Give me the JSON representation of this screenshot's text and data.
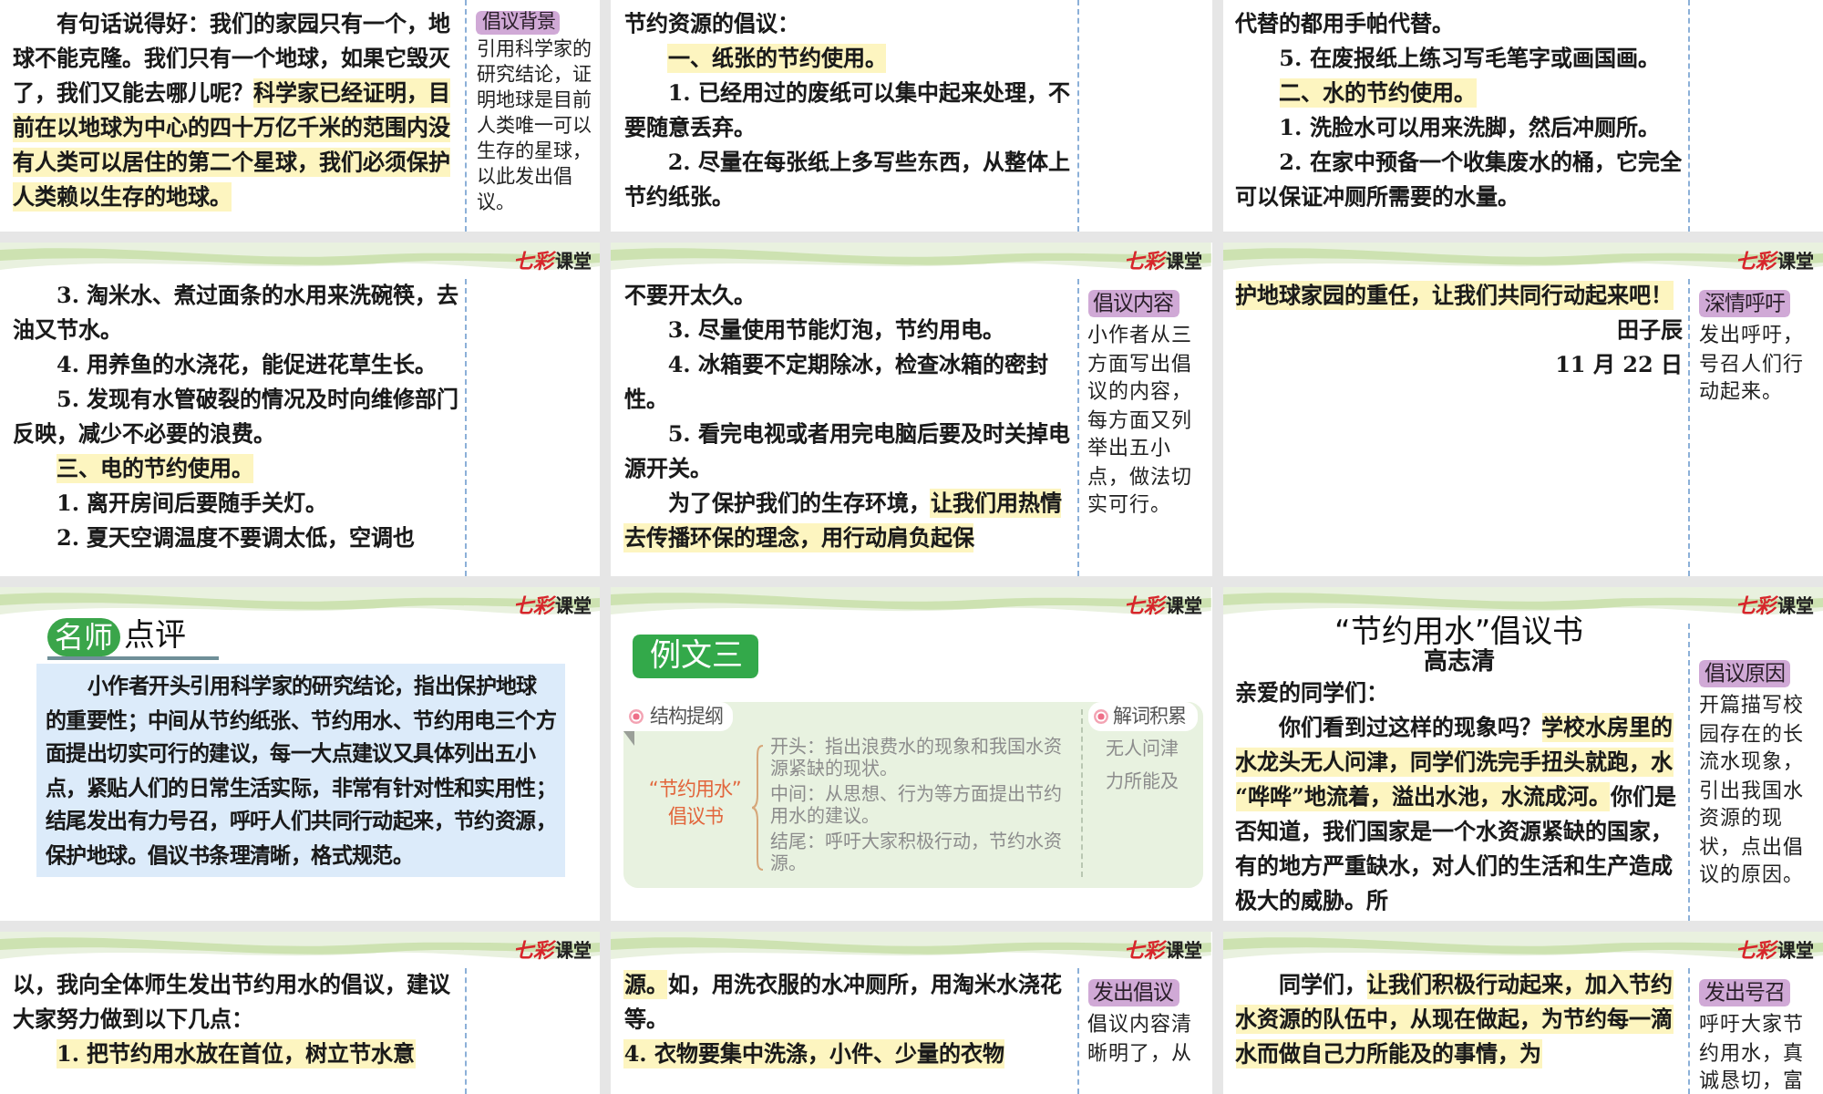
{
  "slides": [
    {
      "kind": "letter",
      "blocks": [
        {
          "kind": "paragraph",
          "indent": true,
          "segments": [
            {
              "text": "有句话说得好：我们的家园只有一个，地球不能克隆。我们只有一个地球，如果它毁灭了，我们又能去哪儿呢？",
              "highlighted": false
            },
            {
              "text": "科学家已经证明，目前在以地球为中心的四十万亿千米的范围内没有人类可以居住的第二个星球，我们必须保护人类赖以生存的地球。",
              "highlighted": true
            }
          ]
        }
      ],
      "note": {
        "label": "倡议背景",
        "text": "引用科学家的研究结论，证明地球是目前人类唯一可以生存的星球，以此发出倡议。"
      }
    },
    {
      "kind": "letter",
      "blocks": [
        {
          "kind": "paragraph",
          "indent": false,
          "segments": [
            {
              "text": "节约资源的倡议：",
              "highlighted": false
            }
          ]
        },
        {
          "kind": "paragraph",
          "indent": true,
          "segments": [
            {
              "text": "一、纸张的节约使用。",
              "highlighted": true
            }
          ]
        },
        {
          "kind": "paragraph",
          "indent": true,
          "segments": [
            {
              "text": "1. 已经用过的废纸可以集中起来处理，不要随意丢弃。",
              "highlighted": false
            }
          ]
        },
        {
          "kind": "paragraph",
          "indent": true,
          "segments": [
            {
              "text": "2. 尽量在每张纸上多写些东西，从整体上节约纸张。",
              "highlighted": false
            }
          ]
        }
      ]
    },
    {
      "kind": "letter",
      "blocks": [
        {
          "kind": "paragraph",
          "indent": false,
          "segments": [
            {
              "text": "代替的都用手帕代替。",
              "highlighted": false
            }
          ]
        },
        {
          "kind": "paragraph",
          "indent": true,
          "segments": [
            {
              "text": "5. 在废报纸上练习写毛笔字或画国画。",
              "highlighted": false
            }
          ]
        },
        {
          "kind": "paragraph",
          "indent": true,
          "segments": [
            {
              "text": "二、水的节约使用。",
              "highlighted": true
            }
          ]
        },
        {
          "kind": "paragraph",
          "indent": true,
          "segments": [
            {
              "text": "1. 洗脸水可以用来洗脚，然后冲厕所。",
              "highlighted": false
            }
          ]
        },
        {
          "kind": "paragraph",
          "indent": true,
          "segments": [
            {
              "text": "2. 在家中预备一个收集废水的桶，它完全可以保证冲厕所需要的水量。",
              "highlighted": false
            }
          ]
        }
      ]
    },
    {
      "kind": "letter",
      "logo": {
        "mark": "七彩",
        "word": "课堂"
      },
      "blocks": [
        {
          "kind": "paragraph",
          "indent": true,
          "segments": [
            {
              "text": "3. 淘米水、煮过面条的水用来洗碗筷，去油又节水。",
              "highlighted": false
            }
          ]
        },
        {
          "kind": "paragraph",
          "indent": true,
          "segments": [
            {
              "text": "4. 用养鱼的水浇花，能促进花草生长。",
              "highlighted": false
            }
          ]
        },
        {
          "kind": "paragraph",
          "indent": true,
          "segments": [
            {
              "text": "5. 发现有水管破裂的情况及时向维修部门反映，减少不必要的浪费。",
              "highlighted": false
            }
          ]
        },
        {
          "kind": "paragraph",
          "indent": true,
          "segments": [
            {
              "text": "三、电的节约使用。",
              "highlighted": true
            }
          ]
        },
        {
          "kind": "paragraph",
          "indent": true,
          "segments": [
            {
              "text": "1. 离开房间后要随手关灯。",
              "highlighted": false
            }
          ]
        },
        {
          "kind": "paragraph",
          "indent": true,
          "segments": [
            {
              "text": "2. 夏天空调温度不要调太低，空调也",
              "highlighted": false
            }
          ]
        }
      ]
    },
    {
      "kind": "letter",
      "logo": {
        "mark": "七彩",
        "word": "课堂"
      },
      "blocks": [
        {
          "kind": "paragraph",
          "indent": false,
          "segments": [
            {
              "text": "不要开太久。",
              "highlighted": false
            }
          ]
        },
        {
          "kind": "paragraph",
          "indent": true,
          "segments": [
            {
              "text": "3. 尽量使用节能灯泡，节约用电。",
              "highlighted": false
            }
          ]
        },
        {
          "kind": "paragraph",
          "indent": true,
          "segments": [
            {
              "text": "4. 冰箱要不定期除冰，检查冰箱的密封性。",
              "highlighted": false
            }
          ]
        },
        {
          "kind": "paragraph",
          "indent": true,
          "segments": [
            {
              "text": "5. 看完电视或者用完电脑后要及时关掉电源开关。",
              "highlighted": false
            }
          ]
        },
        {
          "kind": "paragraph",
          "indent": true,
          "segments": [
            {
              "text": "为了保护我们的生存环境，",
              "highlighted": false
            },
            {
              "text": "让我们用热情去传播环保的理念，用行动肩负起保",
              "highlighted": true
            }
          ]
        }
      ],
      "note": {
        "label": "倡议内容",
        "text": "小作者从三方面写出倡议的内容，每方面又列举出五小点，做法切实可行。"
      }
    },
    {
      "kind": "letter",
      "logo": {
        "mark": "七彩",
        "word": "课堂"
      },
      "blocks": [
        {
          "kind": "paragraph",
          "indent": false,
          "segments": [
            {
              "text": "护地球家园的重任，让我们共同行动起来吧！",
              "highlighted": true
            }
          ]
        },
        {
          "kind": "signature",
          "text": "田子辰"
        },
        {
          "kind": "signature",
          "text": "11 月 22 日"
        }
      ],
      "note": {
        "label": "深情呼吁",
        "text": "发出呼吁，号召人们行动起来。"
      }
    },
    {
      "kind": "review",
      "logo": {
        "mark": "七彩",
        "word": "课堂"
      },
      "badge": "名师",
      "heading": "点评",
      "text": "小作者开头引用科学家的研究结论，指出保护地球的重要性；中间从节约纸张、节约用水、节约用电三个方面提出切实可行的建议，每一大点建议又具体列出五小点，紧贴人们的日常生活实际，非常有针对性和实用性；结尾发出有力号召，呼吁人们共同行动起来，节约资源，保护地球。倡议书条理清晰，格式规范。"
    },
    {
      "kind": "outline",
      "logo": {
        "mark": "七彩",
        "word": "课堂"
      },
      "label": "例文三",
      "outline": {
        "label": "结构提纲",
        "topic": "“节约用水”倡议书",
        "items": [
          "开头：指出浪费水的现象和我国水资源紧缺的现状。",
          "中间：从思想、行为等方面提出节约用水的建议。",
          "结尾：呼吁大家积极行动，节约水资源。"
        ]
      },
      "glossary": {
        "label": "解词积累",
        "words": [
          "无人问津",
          "力所能及"
        ]
      }
    },
    {
      "kind": "letter",
      "logo": {
        "mark": "七彩",
        "word": "课堂"
      },
      "title": "“节约用水”倡议书",
      "author": "高志清",
      "blocks": [
        {
          "kind": "paragraph",
          "indent": false,
          "segments": [
            {
              "text": "亲爱的同学们：",
              "highlighted": false
            }
          ]
        },
        {
          "kind": "paragraph",
          "indent": true,
          "segments": [
            {
              "text": "你们看到过这样的现象吗？",
              "highlighted": false
            },
            {
              "text": "学校水房里的水龙头无人问津，同学们洗完手扭头就跑，水“哗哗”地流着，溢出水池，水流成河。",
              "highlighted": true
            },
            {
              "text": "你们是否知道，我们国家是一个水资源紧缺的国家，有的地方严重缺水，对人们的生活和生产造成极大的威胁。所",
              "highlighted": false
            }
          ]
        }
      ],
      "note": {
        "label": "倡议原因",
        "text": "开篇描写校园存在的长流水现象，引出我国水资源的现状，点出倡议的原因。"
      }
    },
    {
      "kind": "letter",
      "logo": {
        "mark": "七彩",
        "word": "课堂"
      },
      "blocks": [
        {
          "kind": "paragraph",
          "indent": false,
          "segments": [
            {
              "text": "以，我向全体师生发出节约用水的倡议，建议大家努力做到以下几点：",
              "highlighted": false
            }
          ]
        },
        {
          "kind": "paragraph",
          "indent": true,
          "segments": [
            {
              "text": "1. 把节约用水放在首位，树立节水意",
              "highlighted": true
            }
          ]
        }
      ]
    },
    {
      "kind": "letter",
      "logo": {
        "mark": "七彩",
        "word": "课堂"
      },
      "blocks": [
        {
          "kind": "paragraph",
          "indent": false,
          "segments": [
            {
              "text": "源。",
              "highlighted": true
            },
            {
              "text": "如，用洗衣服的水冲厕所，用淘米水浇花等。",
              "highlighted": false
            }
          ]
        },
        {
          "kind": "paragraph",
          "indent": false,
          "segments": [
            {
              "text": "4. 衣物要集中洗涤，小件、少量的衣物",
              "highlighted": true
            }
          ]
        }
      ],
      "note": {
        "label": "发出倡议",
        "text": "倡议内容清晰明了，从"
      }
    },
    {
      "kind": "letter",
      "logo": {
        "mark": "七彩",
        "word": "课堂"
      },
      "blocks": [
        {
          "kind": "paragraph",
          "indent": true,
          "segments": [
            {
              "text": "同学们，",
              "highlighted": false
            },
            {
              "text": "让我们积极行动起来，加入节约水资源的队伍中，从现在做起，为节约每一滴水而做自己力所能及的事情，为",
              "highlighted": true
            }
          ]
        }
      ],
      "note": {
        "label": "发出号召",
        "text": "呼吁大家节约用水，真诚恳切，富"
      }
    }
  ]
}
